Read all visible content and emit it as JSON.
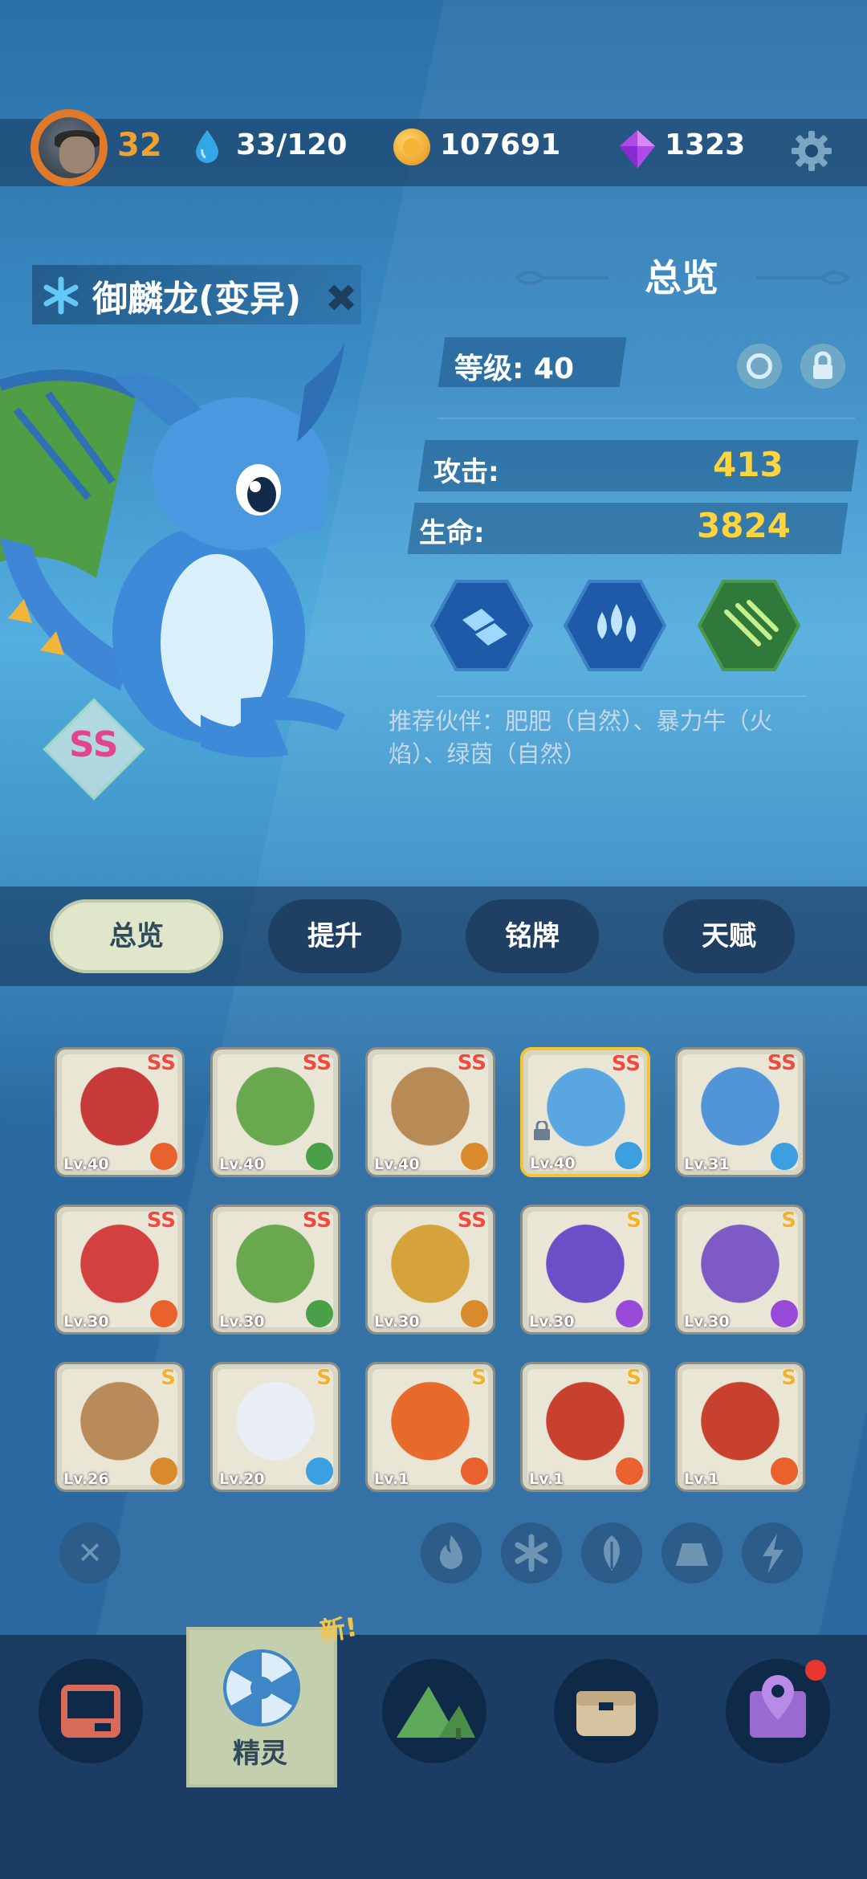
{
  "header": {
    "level": "32",
    "stamina": "33/120",
    "coins": "107691",
    "gems": "1323"
  },
  "pet": {
    "name": "御麟龙(变异)",
    "rank": "SS",
    "overview_title": "总览",
    "level_label": "等级: 40",
    "attack_label": "攻击:",
    "attack_value": "413",
    "hp_label": "生命:",
    "hp_value": "3824",
    "recommend": "推荐伙伴：肥肥（自然）、暴力牛（火焰）、绿茵（自然）"
  },
  "tabs": [
    "总览",
    "提升",
    "铭牌",
    "天赋"
  ],
  "cards": [
    {
      "lv": "Lv.40",
      "rank": "SS",
      "el": "fire"
    },
    {
      "lv": "Lv.40",
      "rank": "SS",
      "el": "leaf"
    },
    {
      "lv": "Lv.40",
      "rank": "SS",
      "el": "earth"
    },
    {
      "lv": "Lv.40",
      "rank": "SS",
      "el": "ice"
    },
    {
      "lv": "Lv.31",
      "rank": "SS",
      "el": "ice"
    },
    {
      "lv": "Lv.30",
      "rank": "SS",
      "el": "fire"
    },
    {
      "lv": "Lv.30",
      "rank": "SS",
      "el": "leaf"
    },
    {
      "lv": "Lv.30",
      "rank": "SS",
      "el": "earth"
    },
    {
      "lv": "Lv.30",
      "rank": "S",
      "el": "bolt"
    },
    {
      "lv": "Lv.30",
      "rank": "S",
      "el": "bolt"
    },
    {
      "lv": "Lv.26",
      "rank": "S",
      "el": "earth"
    },
    {
      "lv": "Lv.20",
      "rank": "S",
      "el": "ice"
    },
    {
      "lv": "Lv.1",
      "rank": "S",
      "el": "fire"
    },
    {
      "lv": "Lv.1",
      "rank": "S",
      "el": "fire"
    },
    {
      "lv": "Lv.1",
      "rank": "S",
      "el": "fire"
    }
  ],
  "nav": {
    "spirit_label": "精灵",
    "new_tag": "新!"
  },
  "colors": {
    "accent_gold": "#ffd43c",
    "level_orange": "#f2a12e",
    "rank_red": "#f24a3c",
    "fire": "#e9612d",
    "leaf": "#4aa048",
    "ice": "#3aa0e2",
    "earth": "#d98a2c",
    "bolt": "#9a4ad9"
  }
}
